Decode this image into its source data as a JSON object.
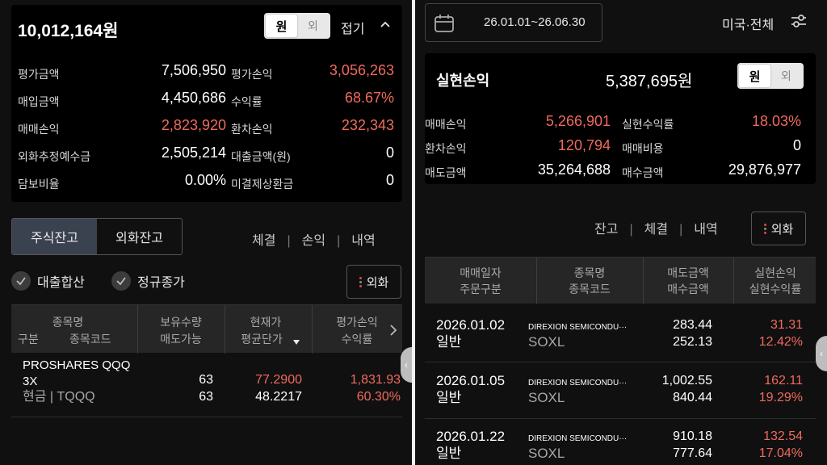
{
  "left": {
    "total": "10,012,164원",
    "currency_toggle": {
      "on": "원",
      "off": "외"
    },
    "collapse_label": "접기",
    "summary_rows": [
      {
        "label1": "평가금액",
        "value1": "7,506,950",
        "label2": "평가손익",
        "value2": "3,056,263"
      },
      {
        "label1": "매입금액",
        "value1": "4,450,686",
        "label2": "수익률",
        "value2": "68.67%"
      },
      {
        "label1": "매매손익",
        "value1": "2,823,920",
        "label2": "환차손익",
        "value2": "232,343"
      },
      {
        "label1": "외화추정예수금",
        "value1": "2,505,214",
        "label2": "대출금액(원)",
        "value2": "0"
      },
      {
        "label1": "담보비율",
        "value1": "0.00%",
        "label2": "미결제상환금",
        "value2": "0"
      }
    ],
    "tabs": [
      "주식잔고",
      "외화잔고"
    ],
    "links": [
      "체결",
      "손익",
      "내역"
    ],
    "checks": [
      "대출합산",
      "정규종가"
    ],
    "fx_button": "외화",
    "table_headers": {
      "col1_top": "종목명",
      "col1_bottom_left": "구분",
      "col1_bottom_right": "종목코드",
      "col2_top": "보유수량",
      "col2_bottom": "매도가능",
      "col3_top": "현재가",
      "col3_bottom": "평균단가",
      "col4_top": "평가손익",
      "col4_bottom": "수익률"
    },
    "rows": [
      {
        "name_line1": "PROSHARES QQQ",
        "name_line2": "3X",
        "type_code": "현금 | TQQQ",
        "qty": "63",
        "sellable": "63",
        "price": "77.2900",
        "avg_price": "48.2217",
        "pnl": "1,831.93",
        "rate": "60.30%"
      }
    ]
  },
  "right": {
    "date_range": "26.01.01~26.06.30",
    "filter_label": "미국·전체",
    "realized_title": "실현손익",
    "realized_total": "5,387,695원",
    "currency_toggle": {
      "on": "원",
      "off": "외"
    },
    "summary_rows": [
      {
        "label1": "매매손익",
        "value1": "5,266,901",
        "label2": "실현수익률",
        "value2": "18.03%"
      },
      {
        "label1": "환차손익",
        "value1": "120,794",
        "label2": "매매비용",
        "value2": "0"
      },
      {
        "label1": "매도금액",
        "value1": "35,264,688",
        "label2": "매수금액",
        "value2": "29,876,977"
      }
    ],
    "links": [
      "잔고",
      "체결",
      "내역"
    ],
    "fx_button": "외화",
    "table_headers": {
      "col1_top": "매매일자",
      "col1_bottom": "주문구분",
      "col2_top": "종목명",
      "col2_bottom": "종목코드",
      "col3_top": "매도금액",
      "col3_bottom": "매수금액",
      "col4_top": "실현손익",
      "col4_bottom": "실현수익률"
    },
    "rows": [
      {
        "date": "2026.01.02",
        "kind": "일반",
        "name": "DIREXION SEMICONDU···",
        "code": "SOXL",
        "sell": "283.44",
        "buy": "252.13",
        "pnl": "31.31",
        "rate": "12.42%"
      },
      {
        "date": "2026.01.05",
        "kind": "일반",
        "name": "DIREXION SEMICONDU···",
        "code": "SOXL",
        "sell": "1,002.55",
        "buy": "840.44",
        "pnl": "162.11",
        "rate": "19.29%"
      },
      {
        "date": "2026.01.22",
        "kind": "일반",
        "name": "DIREXION SEMICONDU···",
        "code": "SOXL",
        "sell": "910.18",
        "buy": "777.64",
        "pnl": "132.54",
        "rate": "17.04%"
      }
    ]
  },
  "colors": {
    "background": "#101010",
    "card": "#000000",
    "positive": "#f06a5e",
    "tab_selected": "#3a4250",
    "header_bg": "#262626"
  },
  "icons": [
    "calendar-icon",
    "filter-sliders-icon",
    "chevron-up-icon",
    "chevron-right-icon",
    "sort-down-icon",
    "check-icon",
    "chevron-left-icon"
  ]
}
